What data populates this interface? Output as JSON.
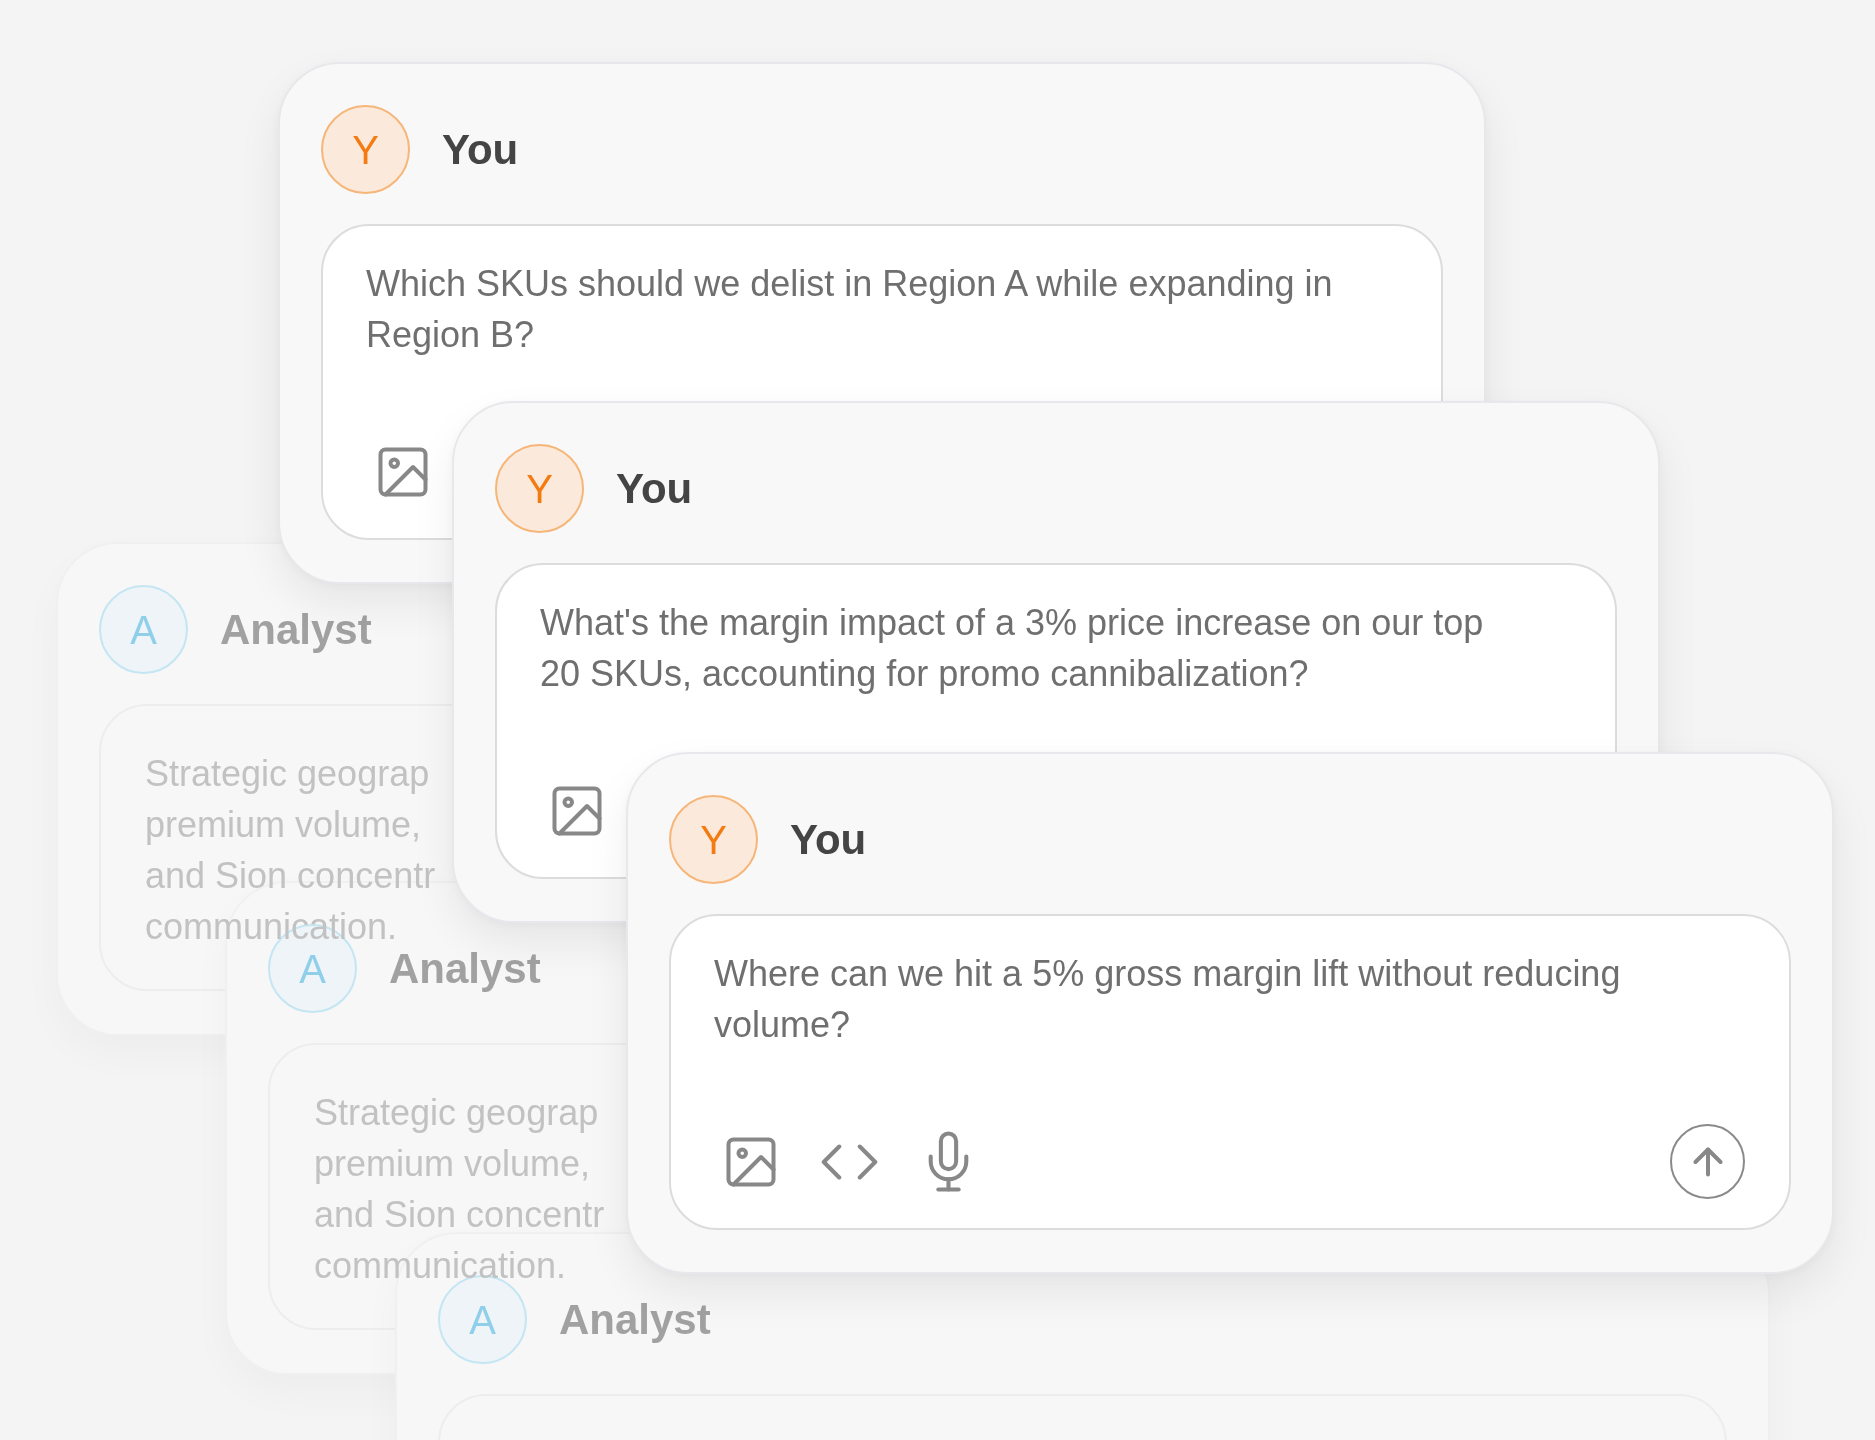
{
  "conversation": [
    {
      "kind": "user",
      "name": "You",
      "initial": "Y",
      "message": "Which SKUs should we delist in Region A while expanding in Region B?"
    },
    {
      "kind": "user",
      "name": "You",
      "initial": "Y",
      "message": "What's the margin impact of a 3% price increase on our top 20 SKUs, accounting for promo cannibalization?"
    },
    {
      "kind": "assistant",
      "name": "Analyst",
      "initial": "A",
      "message_lines": [
        "Strategic geograp",
        "premium volume,",
        "and Sion concentr",
        "communication."
      ]
    },
    {
      "kind": "user",
      "name": "You",
      "initial": "Y",
      "message": "Where can we hit a 5% gross margin lift without reducing volume?"
    },
    {
      "kind": "assistant",
      "name": "Analyst",
      "initial": "A",
      "message_lines": [
        "Strategic geograp",
        "premium volume,",
        "and Sion concentr",
        "communication."
      ]
    },
    {
      "kind": "assistant",
      "name": "Analyst",
      "initial": "A"
    }
  ]
}
